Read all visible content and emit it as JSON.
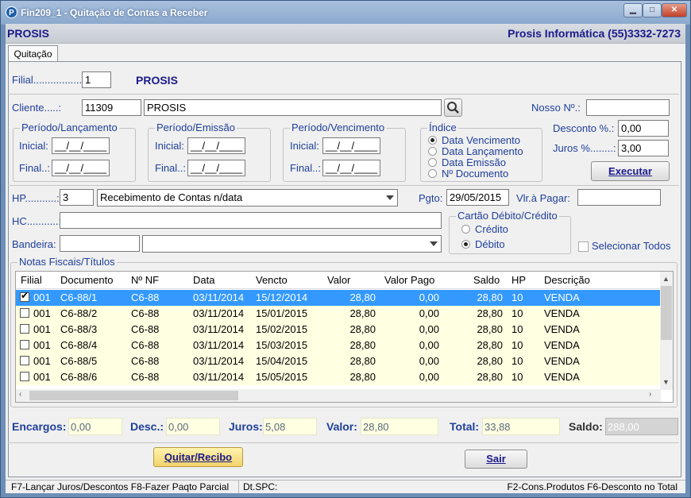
{
  "window": {
    "title": "Fin209_1 - Quitação de Contas a Receber",
    "icon": "P"
  },
  "header": {
    "left": "PROSIS",
    "right": "Prosis Informática (55)3332-7273"
  },
  "tab": "Quitação",
  "filial": {
    "label": "Filial.................:",
    "value": "1",
    "name": "PROSIS"
  },
  "cliente": {
    "label": "Cliente.....:",
    "code": "11309",
    "name": "PROSIS"
  },
  "nosso": {
    "label": "Nosso Nº.:",
    "value": ""
  },
  "periodos": [
    {
      "title": "Período/Lançamento",
      "inicial_label": "Inicial:",
      "final_label": "Final..:",
      "inicial": "__/__/____",
      "final": "__/__/____"
    },
    {
      "title": "Período/Emissão",
      "inicial_label": "Inicial:",
      "final_label": "Final..:",
      "inicial": "__/__/____",
      "final": "__/__/____"
    },
    {
      "title": "Período/Vencimento",
      "inicial_label": "Inicial:",
      "final_label": "Final..:",
      "inicial": "__/__/____",
      "final": "__/__/____"
    }
  ],
  "indice": {
    "title": "Índice",
    "options": [
      "Data Vencimento",
      "Data Lançamento",
      "Data Emissão",
      "Nº Documento"
    ],
    "selected": 0
  },
  "desconto": {
    "label": "Desconto %.:",
    "value": "0,00"
  },
  "juros": {
    "label": "Juros %........:",
    "value": "3,00"
  },
  "executar": "Executar",
  "hp": {
    "label": "HP...........:",
    "code": "3",
    "desc": "Recebimento de Contas n/data"
  },
  "pgto": {
    "label": "Pgto:",
    "value": "29/05/2015"
  },
  "vlr_pagar": {
    "label": "Vlr.à Pagar:",
    "value": ""
  },
  "hc": {
    "label": "HC...........:",
    "value": ""
  },
  "bandeira": {
    "label": "Bandeira:",
    "code": "",
    "desc": ""
  },
  "cartao": {
    "title": "Cartão Débito/Crédito",
    "options": [
      "Crédito",
      "Débito"
    ],
    "selected": 1
  },
  "selecionar_todos": "Selecionar Todos",
  "notas": {
    "title": "Notas Fiscais/Títulos",
    "columns": [
      "Filial",
      "Documento",
      "Nº NF",
      "Data",
      "Vencto",
      "Valor",
      "Valor Pago",
      "Saldo",
      "HP",
      "Descrição"
    ],
    "rows": [
      {
        "checked": true,
        "filial": "001",
        "documento": "C6-88/1",
        "nf": "C6-88",
        "data": "03/11/2014",
        "vencto": "15/12/2014",
        "valor": "28,80",
        "valor_pago": "0,00",
        "saldo": "28,80",
        "hp": "10",
        "descricao": "VENDA"
      },
      {
        "checked": false,
        "filial": "001",
        "documento": "C6-88/2",
        "nf": "C6-88",
        "data": "03/11/2014",
        "vencto": "15/01/2015",
        "valor": "28,80",
        "valor_pago": "0,00",
        "saldo": "28,80",
        "hp": "10",
        "descricao": "VENDA"
      },
      {
        "checked": false,
        "filial": "001",
        "documento": "C6-88/3",
        "nf": "C6-88",
        "data": "03/11/2014",
        "vencto": "15/02/2015",
        "valor": "28,80",
        "valor_pago": "0,00",
        "saldo": "28,80",
        "hp": "10",
        "descricao": "VENDA"
      },
      {
        "checked": false,
        "filial": "001",
        "documento": "C6-88/4",
        "nf": "C6-88",
        "data": "03/11/2014",
        "vencto": "15/03/2015",
        "valor": "28,80",
        "valor_pago": "0,00",
        "saldo": "28,80",
        "hp": "10",
        "descricao": "VENDA"
      },
      {
        "checked": false,
        "filial": "001",
        "documento": "C6-88/5",
        "nf": "C6-88",
        "data": "03/11/2014",
        "vencto": "15/04/2015",
        "valor": "28,80",
        "valor_pago": "0,00",
        "saldo": "28,80",
        "hp": "10",
        "descricao": "VENDA"
      },
      {
        "checked": false,
        "filial": "001",
        "documento": "C6-88/6",
        "nf": "C6-88",
        "data": "03/11/2014",
        "vencto": "15/05/2015",
        "valor": "28,80",
        "valor_pago": "0,00",
        "saldo": "28,80",
        "hp": "10",
        "descricao": "VENDA"
      }
    ]
  },
  "totals": {
    "encargos": {
      "label": "Encargos:",
      "value": "0,00"
    },
    "desc": {
      "label": "Desc.:",
      "value": "0,00"
    },
    "juros": {
      "label": "Juros:",
      "value": "5,08"
    },
    "valor": {
      "label": "Valor:",
      "value": "28,80"
    },
    "total": {
      "label": "Total:",
      "value": "33,88"
    },
    "saldo": {
      "label": "Saldo:",
      "value": "288,00"
    }
  },
  "buttons": {
    "quitar": "Quitar/Recibo",
    "sair": "Sair"
  },
  "status": {
    "left": "F7-Lançar Juros/Descontos F8-Fazer Paqto Parcial",
    "middle": "Dt.SPC:",
    "right": "F2-Cons.Produtos F6-Desconto no Total"
  },
  "colors": {
    "title_text": "#1f3f9b",
    "selected_row": "#3399ff",
    "row_bg": "#ffffe1",
    "window_frame": "#6d8fb7"
  }
}
